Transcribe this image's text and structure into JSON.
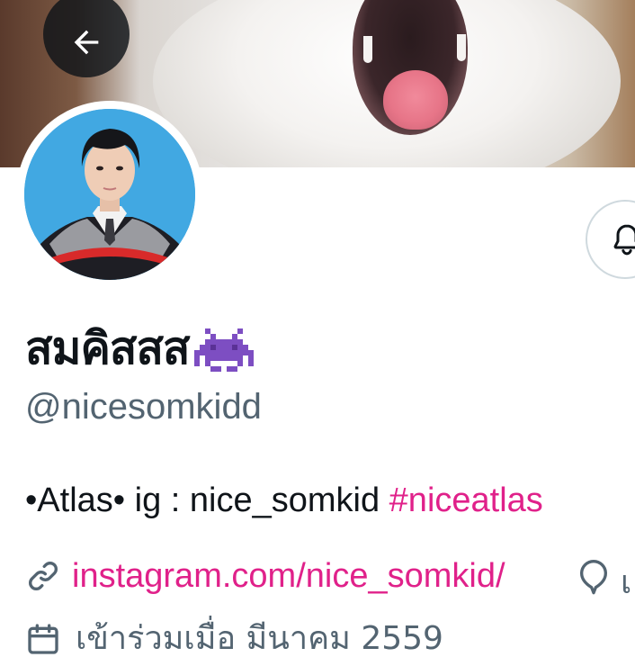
{
  "profile": {
    "display_name": "สมคิสสส",
    "display_name_emoji": "space-invader-icon",
    "handle": "@nicesomkidd",
    "bio": {
      "text": "•Atlas• ig : nice_somkid ",
      "hashtag": "#niceatlas"
    },
    "website": "instagram.com/nice_somkid/",
    "location_partial": "เ",
    "joined_partial": "เข้าร่วมเมื่อ มีนาคม 2559"
  },
  "icons": {
    "back": "arrow-left-icon",
    "notifications": "bell-icon",
    "link": "link-icon",
    "location": "location-pin-icon",
    "joined": "calendar-icon"
  },
  "colors": {
    "accent_link": "#e0218a",
    "secondary_text": "#536471",
    "primary_text": "#0f1419",
    "border": "#cfd9de"
  }
}
